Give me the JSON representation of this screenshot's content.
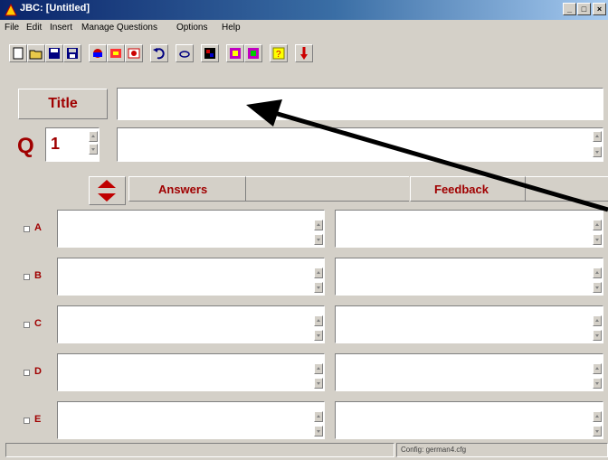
{
  "window": {
    "title": "JBC: [Untitled]",
    "controls": [
      "_",
      "□",
      "×"
    ]
  },
  "menu": [
    "File",
    "Edit",
    "Insert",
    "Manage Questions",
    "Options",
    "Help"
  ],
  "toolbar": {
    "buttons": [
      "new-file-icon",
      "open-folder-icon",
      "save-icon",
      "save-as-icon",
      "hotpot-icon",
      "rhubarb-icon",
      "web-icon",
      "undo-icon",
      "search-icon",
      "config-icon",
      "html-export-1-icon",
      "html-export-2-icon",
      "help-icon",
      "exit-icon"
    ]
  },
  "form": {
    "title_label": "Title",
    "title_value": "",
    "q_label": "Q",
    "q_number": "1",
    "question_text": "",
    "answers_header": "Answers",
    "feedback_header": "Feedback",
    "rows": [
      {
        "letter": "A",
        "answer": "",
        "feedback": ""
      },
      {
        "letter": "B",
        "answer": "",
        "feedback": ""
      },
      {
        "letter": "C",
        "answer": "",
        "feedback": ""
      },
      {
        "letter": "D",
        "answer": "",
        "feedback": ""
      },
      {
        "letter": "E",
        "answer": "",
        "feedback": ""
      }
    ]
  },
  "status": {
    "config": "Config: german4.cfg"
  },
  "colors": {
    "label_red": "#a00000",
    "titlebar_start": "#0a246a",
    "arrow": "#000000"
  }
}
